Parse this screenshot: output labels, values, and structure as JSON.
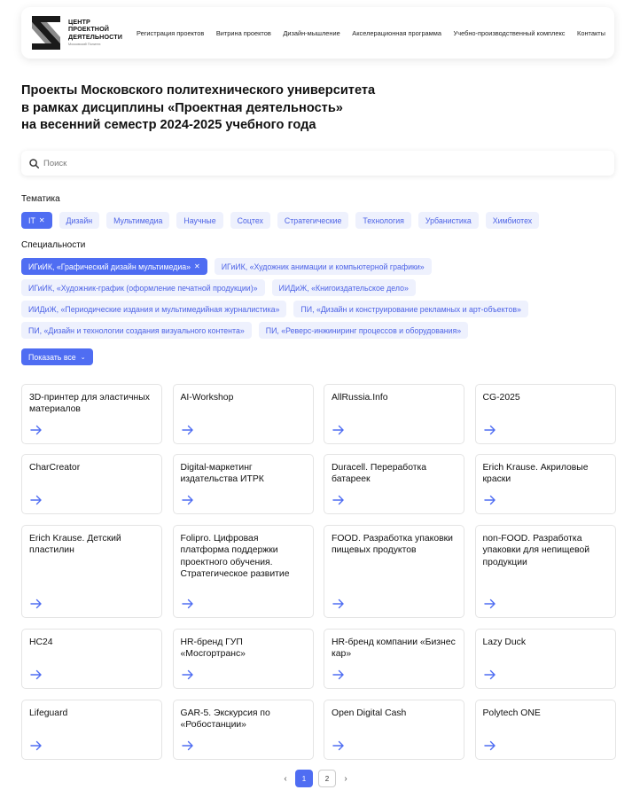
{
  "header": {
    "logo_lines": [
      "ЦЕНТР",
      "ПРОЕКТНОЙ",
      "ДЕЯТЕЛЬНОСТИ"
    ],
    "logo_sub": "Московский Политех",
    "nav": [
      "Регистрация проектов",
      "Витрина проектов",
      "Дизайн-мышление",
      "Акселерационная программа",
      "Учебно-производственный комплекс",
      "Контакты"
    ]
  },
  "title_lines": [
    "Проекты Московского политехнического университета",
    "в рамках дисциплины «Проектная деятельность»",
    "на весенний семестр 2024-2025 учебного года"
  ],
  "search": {
    "placeholder": "Поиск"
  },
  "themes": {
    "label": "Тематика",
    "items": [
      {
        "label": "IT",
        "active": true
      },
      {
        "label": "Дизайн",
        "active": false
      },
      {
        "label": "Мультимедиа",
        "active": false
      },
      {
        "label": "Научные",
        "active": false
      },
      {
        "label": "Соцтех",
        "active": false
      },
      {
        "label": "Стратегические",
        "active": false
      },
      {
        "label": "Технология",
        "active": false
      },
      {
        "label": "Урбанистика",
        "active": false
      },
      {
        "label": "Химбиотех",
        "active": false
      }
    ]
  },
  "specialties": {
    "label": "Специальности",
    "items": [
      {
        "label": "ИГиИК, «Графический дизайн мультимедиа»",
        "active": true
      },
      {
        "label": "ИГиИК, «Художник анимации и компьютерной графики»",
        "active": false
      },
      {
        "label": "ИГиИК, «Художник-график (оформление печатной продукции)»",
        "active": false
      },
      {
        "label": "ИИДиЖ, «Книгоиздательское дело»",
        "active": false
      },
      {
        "label": "ИИДиЖ, «Периодические издания и мультимедийная журналистика»",
        "active": false
      },
      {
        "label": "ПИ, «Дизайн и конструирование рекламных и арт-объектов»",
        "active": false
      },
      {
        "label": "ПИ, «Дизайн и технологии создания визуального контента»",
        "active": false
      },
      {
        "label": "ПИ, «Реверс-инжиниринг процессов и оборудования»",
        "active": false
      }
    ],
    "show_all": "Показать все"
  },
  "projects": [
    "3D-принтер для эластичных материалов",
    "AI-Workshop",
    "AllRussia.Info",
    "CG-2025",
    "CharCreator",
    "Digital-маркетинг издательства ИТРК",
    "Duracell. Переработка батареек",
    "Erich Krause. Акриловые краски",
    "Erich Krause. Детский пластилин",
    "Folipro. Цифровая платформа поддержки проектного обучения. Стратегическое развитие",
    "FOOD. Разработка упаковки пищевых продуктов",
    "non-FOOD. Разработка упаковки для непищевой продукции",
    "HC24",
    "HR-бренд ГУП «Мосгортранс»",
    "HR-бренд компании «Бизнес кар»",
    "Lazy Duck",
    "Lifeguard",
    "GAR-5. Экскурсия по «Робостанции»",
    "Open Digital Cash",
    "Polytech ONE"
  ],
  "pagination": {
    "pages": [
      "1",
      "2"
    ],
    "current": "1"
  },
  "colors": {
    "accent": "#4f6df2",
    "chip_bg": "#eef1fd",
    "chip_text": "#4d63e6"
  },
  "icons": {
    "search": "search-icon",
    "arrow": "arrow-right-icon",
    "close": "close-icon",
    "chevron": "chevron-down-icon"
  }
}
